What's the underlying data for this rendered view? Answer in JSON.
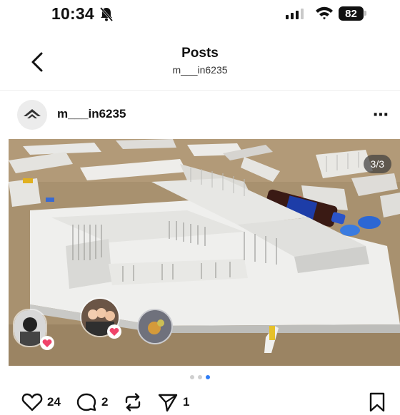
{
  "status_bar": {
    "time": "10:34",
    "battery": "82"
  },
  "header": {
    "title": "Posts",
    "subtitle": "m___in6235"
  },
  "post": {
    "username": "m___in6235",
    "image_counter": "3/3",
    "carousel": {
      "total": 3,
      "active_index": 3
    },
    "likes": "24",
    "comments": "2",
    "shares": "1"
  },
  "colors": {
    "accent": "#2f7df6",
    "heart": "#f0446a"
  }
}
